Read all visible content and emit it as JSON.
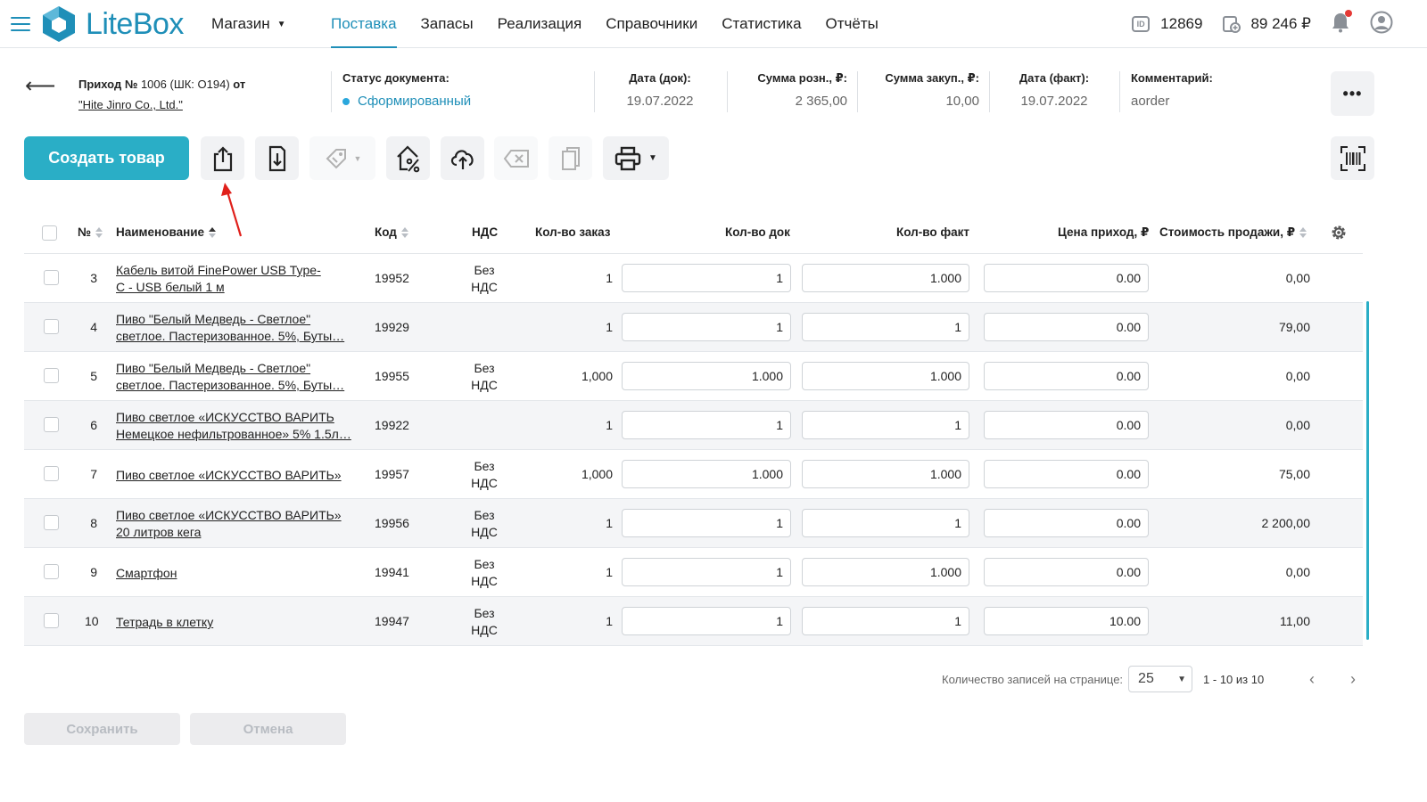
{
  "topbar": {
    "brand": "LiteBox",
    "store": "Магазин",
    "nav": [
      "Поставка",
      "Запасы",
      "Реализация",
      "Справочники",
      "Статистика",
      "Отчёты"
    ],
    "active_nav": "Поставка",
    "id_badge": "ID",
    "user_id": "12869",
    "balance": "89 246 ₽"
  },
  "document": {
    "title_prefix": "Приход №",
    "number": "1006",
    "barcode": "(ШК: О194)",
    "from": "от",
    "supplier": "\"Hite Jinro Co., Ltd.\"",
    "status_label": "Статус документа:",
    "status_value": "Сформированный",
    "date_doc_label": "Дата (док):",
    "date_doc_value": "19.07.2022",
    "sum_retail_label": "Сумма розн., ₽:",
    "sum_retail_value": "2 365,00",
    "sum_purchase_label": "Сумма закуп., ₽:",
    "sum_purchase_value": "10,00",
    "date_fact_label": "Дата (факт):",
    "date_fact_value": "19.07.2022",
    "comment_label": "Комментарий:",
    "comment_value": "aorder",
    "more": "•••"
  },
  "toolbar": {
    "create_label": "Создать товар"
  },
  "table": {
    "headers": {
      "num": "№",
      "name": "Наименование",
      "code": "Код",
      "vat": "НДС",
      "qty_order": "Кол-во заказ",
      "qty_doc": "Кол-во док",
      "qty_fact": "Кол-во факт",
      "price_in": "Цена приход, ₽",
      "sale_cost": "Стоимость продажи, ₽"
    },
    "rows": [
      {
        "num": "3",
        "name1": "Кабель витой FinePower USB Type-",
        "name2": "C - USB белый 1 м",
        "code": "19952",
        "vat1": "Без",
        "vat2": "НДС",
        "qty_order": "1",
        "qty_doc": "1",
        "qty_fact": "1.000",
        "price_in": "0.00",
        "sale": "0,00"
      },
      {
        "num": "4",
        "name1": "Пиво \"Белый Медведь - Светлое\"",
        "name2": "светлое. Пастеризованное. 5%, Буты…",
        "code": "19929",
        "vat1": "",
        "vat2": "",
        "qty_order": "1",
        "qty_doc": "1",
        "qty_fact": "1",
        "price_in": "0.00",
        "sale": "79,00"
      },
      {
        "num": "5",
        "name1": "Пиво \"Белый Медведь - Светлое\"",
        "name2": "светлое. Пастеризованное. 5%, Буты…",
        "code": "19955",
        "vat1": "Без",
        "vat2": "НДС",
        "qty_order": "1,000",
        "qty_doc": "1.000",
        "qty_fact": "1.000",
        "price_in": "0.00",
        "sale": "0,00"
      },
      {
        "num": "6",
        "name1": "Пиво светлое «ИСКУССТВО ВАРИТЬ",
        "name2": "Немецкое нефильтрованное» 5% 1.5л…",
        "code": "19922",
        "vat1": "",
        "vat2": "",
        "qty_order": "1",
        "qty_doc": "1",
        "qty_fact": "1",
        "price_in": "0.00",
        "sale": "0,00"
      },
      {
        "num": "7",
        "name1": "Пиво светлое «ИСКУССТВО ВАРИТЬ»",
        "name2": "",
        "code": "19957",
        "vat1": "Без",
        "vat2": "НДС",
        "qty_order": "1,000",
        "qty_doc": "1.000",
        "qty_fact": "1.000",
        "price_in": "0.00",
        "sale": "75,00"
      },
      {
        "num": "8",
        "name1": "Пиво светлое «ИСКУССТВО ВАРИТЬ»",
        "name2": "20 литров кега",
        "code": "19956",
        "vat1": "Без",
        "vat2": "НДС",
        "qty_order": "1",
        "qty_doc": "1",
        "qty_fact": "1",
        "price_in": "0.00",
        "sale": "2 200,00"
      },
      {
        "num": "9",
        "name1": "Смартфон",
        "name2": "",
        "code": "19941",
        "vat1": "Без",
        "vat2": "НДС",
        "qty_order": "1",
        "qty_doc": "1",
        "qty_fact": "1.000",
        "price_in": "0.00",
        "sale": "0,00"
      },
      {
        "num": "10",
        "name1": "Тетрадь в клетку",
        "name2": "",
        "code": "19947",
        "vat1": "Без",
        "vat2": "НДС",
        "qty_order": "1",
        "qty_doc": "1",
        "qty_fact": "1",
        "price_in": "10.00",
        "sale": "11,00"
      }
    ]
  },
  "pagination": {
    "per_page_label": "Количество записей на странице:",
    "per_page_value": "25",
    "range": "1 - 10 из 10"
  },
  "footer": {
    "save_label": "Сохранить",
    "cancel_label": "Отмена"
  },
  "colors": {
    "accent": "#1f8fb8",
    "create_button": "#2aaec6",
    "annotation_arrow": "#e0201b"
  }
}
